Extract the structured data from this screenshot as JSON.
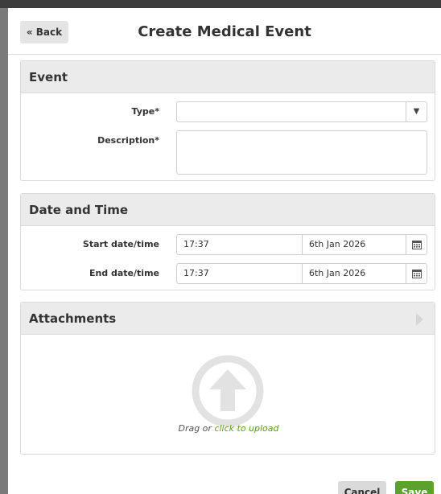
{
  "header": {
    "back_label": "« Back",
    "title": "Create Medical Event"
  },
  "event_panel": {
    "title": "Event",
    "type_label": "Type*",
    "type_value": "",
    "description_label": "Description*",
    "description_value": ""
  },
  "datetime_panel": {
    "title": "Date and Time",
    "start_label": "Start date/time",
    "start_time": "17:37",
    "start_date": "6th Jan 2026",
    "end_label": "End date/time",
    "end_time": "17:37",
    "end_date": "6th Jan 2026"
  },
  "attachments_panel": {
    "title": "Attachments",
    "drag_prefix": "Drag or ",
    "upload_link": "click to upload"
  },
  "footer": {
    "cancel_label": "Cancel",
    "save_label": "Save"
  },
  "colors": {
    "accent_green": "#5aa12e",
    "link_green": "#5a9a1c",
    "panel_header": "#ebebeb"
  },
  "icons": [
    "dropdown-arrow-icon",
    "calendar-icon",
    "upload-icon",
    "collapse-arrow-icon"
  ]
}
